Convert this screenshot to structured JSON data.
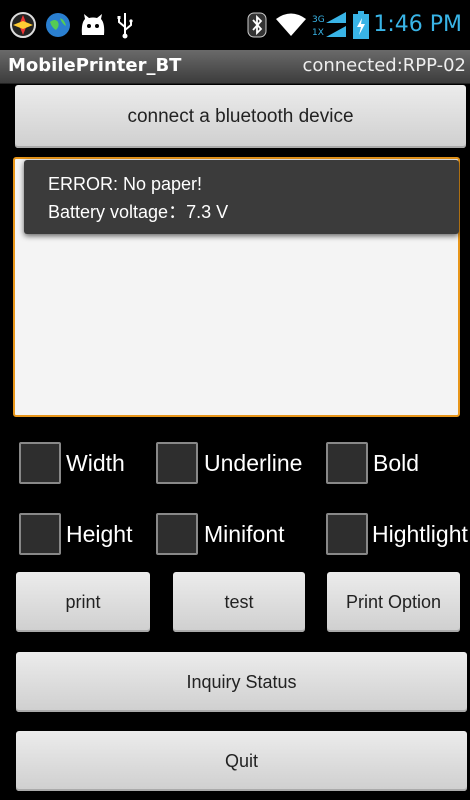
{
  "status_bar": {
    "time": "1:46 PM",
    "icons": [
      "app-icon",
      "globe-icon",
      "cat-icon",
      "usb-icon",
      "bluetooth-icon",
      "wifi-icon",
      "signal-icon",
      "battery-charging-icon"
    ],
    "network_label_top": "3G",
    "network_label_bottom": "1X"
  },
  "title_bar": {
    "app_name": "MobilePrinter_BT",
    "connection": "connected:RPP-02"
  },
  "connect_button_label": "connect a bluetooth device",
  "toast": {
    "line1": "ERROR: No paper!",
    "line2": "Battery voltage：7.3 V"
  },
  "options": {
    "width": "Width",
    "underline": "Underline",
    "bold": "Bold",
    "height": "Height",
    "minifont": "Minifont",
    "highlight": "Hightlight"
  },
  "buttons": {
    "print": "print",
    "test": "test",
    "print_option": "Print Option",
    "inquiry_status": "Inquiry Status",
    "quit": "Quit"
  },
  "colors": {
    "accent_orange": "#e8961a",
    "clock_blue": "#39b4e6"
  }
}
